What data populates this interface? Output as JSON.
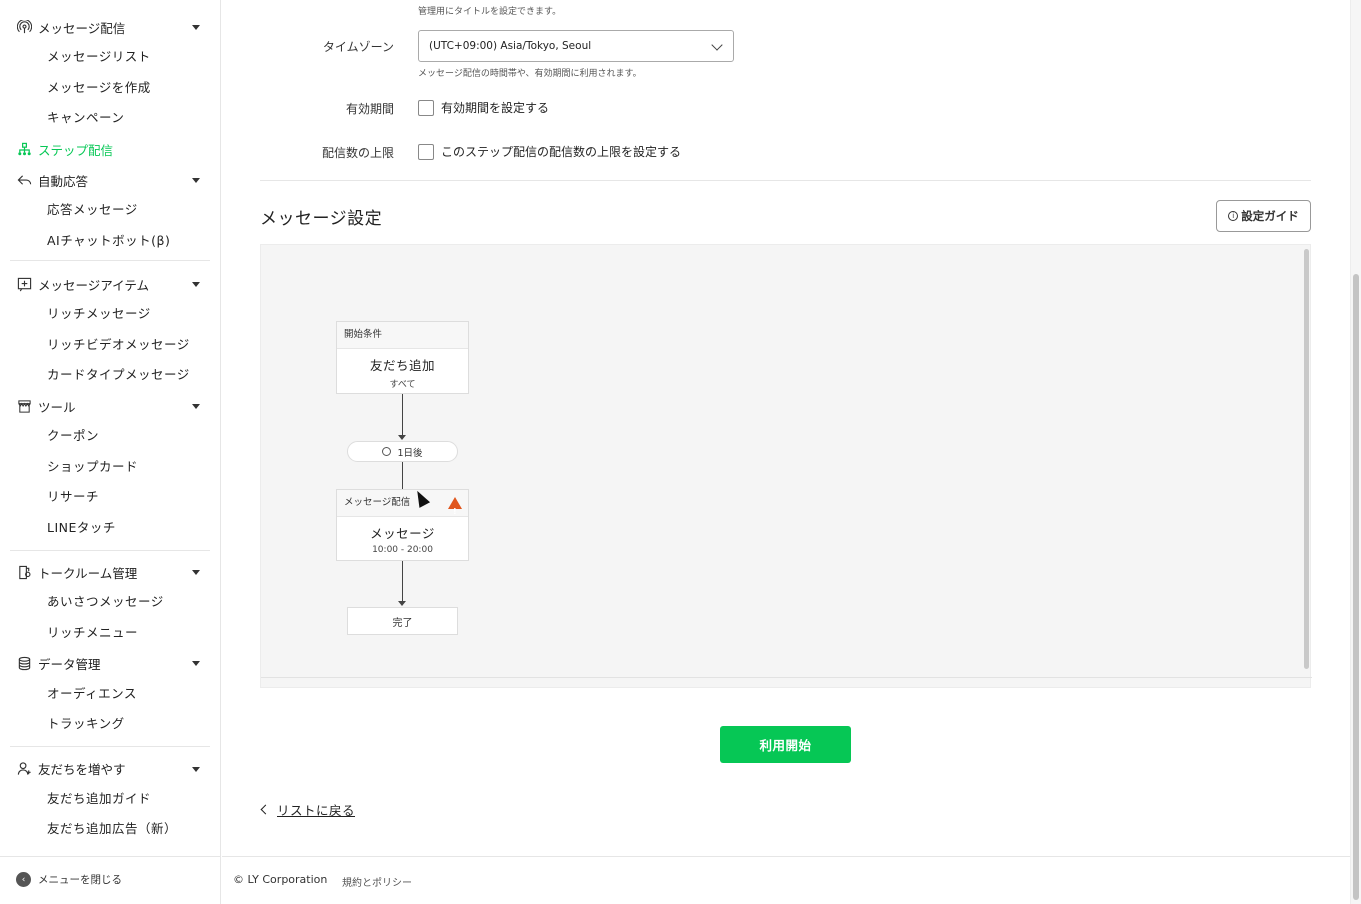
{
  "sidebar": {
    "sections": [
      {
        "label": "メッセージ配信",
        "icon": "broadcast-icon",
        "items": [
          "メッセージリスト",
          "メッセージを作成",
          "キャンペーン"
        ]
      },
      {
        "label": "ステップ配信",
        "icon": "flow-icon",
        "active": true
      },
      {
        "label": "自動応答",
        "icon": "reply-icon",
        "items": [
          "応答メッセージ",
          "AIチャットボット(β)"
        ]
      },
      {
        "label": "メッセージアイテム",
        "icon": "add-box-icon",
        "items": [
          "リッチメッセージ",
          "リッチビデオメッセージ",
          "カードタイプメッセージ"
        ]
      },
      {
        "label": "ツール",
        "icon": "store-icon",
        "items": [
          "クーポン",
          "ショップカード",
          "リサーチ",
          "LINEタッチ"
        ]
      },
      {
        "label": "トークルーム管理",
        "icon": "talkroom-icon",
        "items": [
          "あいさつメッセージ",
          "リッチメニュー"
        ]
      },
      {
        "label": "データ管理",
        "icon": "database-icon",
        "items": [
          "オーディエンス",
          "トラッキング"
        ]
      },
      {
        "label": "友だちを増やす",
        "icon": "add-friend-icon",
        "items": [
          "友だち追加ガイド",
          "友だち追加広告（新）"
        ]
      }
    ],
    "close_menu": "メニューを閉じる"
  },
  "form": {
    "title_helper": "管理用にタイトルを設定できます。",
    "timezone_label": "タイムゾーン",
    "timezone_value": "(UTC+09:00) Asia/Tokyo, Seoul",
    "timezone_helper": "メッセージ配信の時間帯や、有効期間に利用されます。",
    "validity_label": "有効期間",
    "validity_checkbox": "有効期間を設定する",
    "limit_label": "配信数の上限",
    "limit_checkbox": "このステップ配信の配信数の上限を設定する"
  },
  "message_settings": {
    "title": "メッセージ設定",
    "guide_button": "設定ガイド",
    "flow": {
      "start": {
        "head": "開始条件",
        "title": "友だち追加",
        "sub": "すべて"
      },
      "delay": "1日後",
      "message": {
        "head": "メッセージ配信",
        "title": "メッセージ",
        "sub": "10:00 - 20:00",
        "warning": "!"
      },
      "end": "完了"
    }
  },
  "actions": {
    "start_button": "利用開始",
    "back_link": "リストに戻る"
  },
  "footer": {
    "copyright": "© LY Corporation",
    "policy": "規約とポリシー"
  },
  "colors": {
    "accent": "#06c755",
    "warning": "#e0561d"
  }
}
